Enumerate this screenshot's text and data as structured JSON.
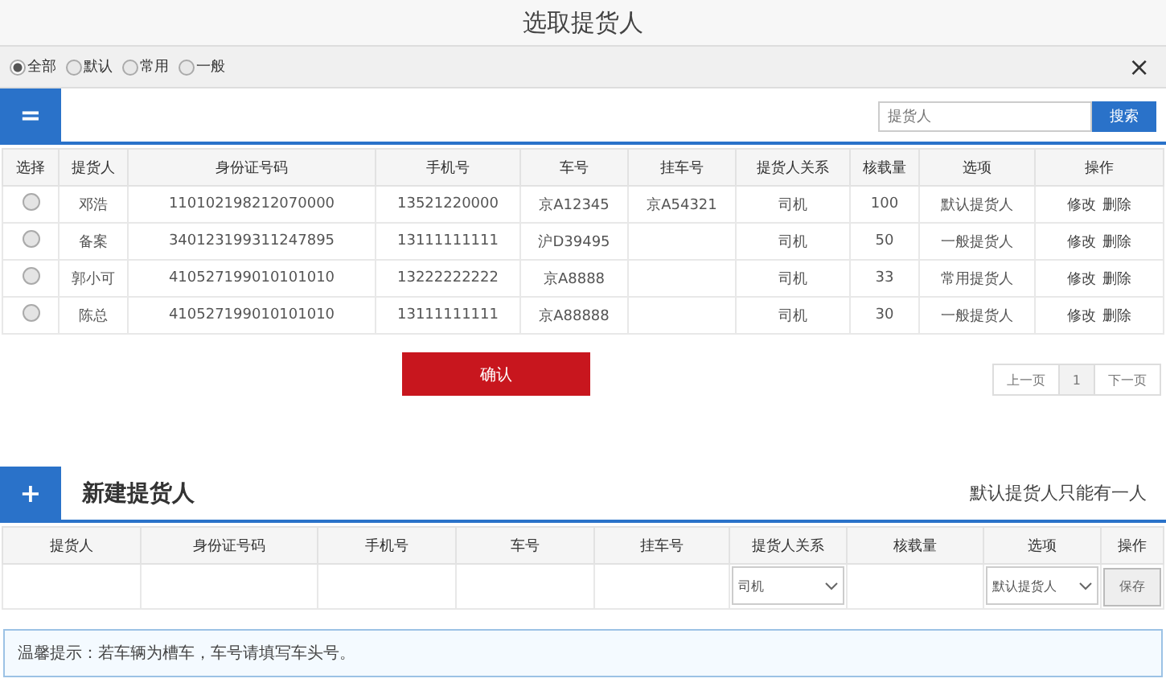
{
  "title": "选取提货人",
  "filters": [
    {
      "label": "全部",
      "selected": true
    },
    {
      "label": "默认",
      "selected": false
    },
    {
      "label": "常用",
      "selected": false
    },
    {
      "label": "一般",
      "selected": false
    }
  ],
  "close": "×",
  "menu_button": "=",
  "search": {
    "placeholder": "提货人",
    "button": "搜索"
  },
  "table": {
    "columns": [
      "选择",
      "提货人",
      "身份证号码",
      "手机号",
      "车号",
      "挂车号",
      "提货人关系",
      "核载量",
      "选项",
      "操作"
    ],
    "rows": [
      {
        "selected": false,
        "cells": [
          "",
          "邓浩",
          "110102198212070000",
          "13521220000",
          "京A12345",
          "京A54321",
          "司机",
          "100",
          "默认提货人"
        ],
        "actions": [
          "修改",
          "删除"
        ]
      },
      {
        "selected": false,
        "cells": [
          "",
          "备案",
          "340123199311247895",
          "13111111111",
          "沪D39495",
          "",
          "司机",
          "50",
          "一般提货人"
        ],
        "actions": [
          "修改",
          "删除"
        ]
      },
      {
        "selected": false,
        "cells": [
          "",
          "郭小可",
          "410527199010101010",
          "13222222222",
          "京A8888",
          "",
          "司机",
          "33",
          "常用提货人"
        ],
        "actions": [
          "修改",
          "删除"
        ]
      },
      {
        "selected": false,
        "cells": [
          "",
          "陈总",
          "410527199010101010",
          "13111111111",
          "京A88888",
          "",
          "司机",
          "30",
          "一般提货人"
        ],
        "actions": [
          "修改",
          "删除"
        ]
      }
    ]
  },
  "confirm": "确认",
  "pagination": [
    {
      "label": "上一页",
      "selected": false
    },
    {
      "label": "1",
      "selected": true
    },
    {
      "label": "下一页",
      "selected": false
    }
  ],
  "new_section": {
    "icon": "+",
    "title": "新建提货人",
    "note": "默认提货人只能有一人",
    "columns": [
      "提货人",
      "身份证号码",
      "手机号",
      "车号",
      "挂车号",
      "提货人关系",
      "核载量",
      "选项",
      "操作"
    ],
    "fields": [
      {
        "kind": "input"
      },
      {
        "kind": "input"
      },
      {
        "kind": "input"
      },
      {
        "kind": "input"
      },
      {
        "kind": "input"
      },
      {
        "kind": "select",
        "value": "司机"
      },
      {
        "kind": "input"
      },
      {
        "kind": "select",
        "value": "默认提货人"
      },
      {
        "kind": "button",
        "label": "保存"
      }
    ]
  },
  "tip": "温馨提示：若车辆为槽车，车号请填写车头号。"
}
